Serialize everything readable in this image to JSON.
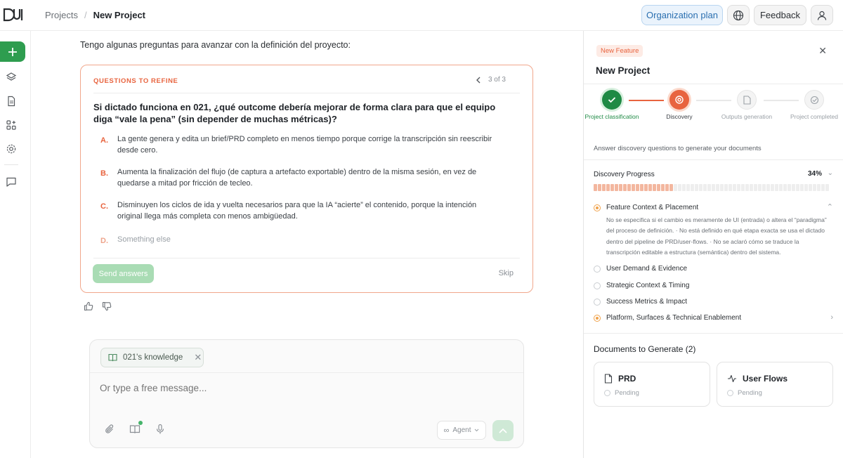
{
  "header": {
    "breadcrumb_root": "Projects",
    "breadcrumb_sep": "/",
    "breadcrumb_current": "New Project",
    "org_plan_label": "Organization plan",
    "feedback_label": "Feedback"
  },
  "colors": {
    "brand_green": "#2e9d4f",
    "accent_orange": "#e8643f",
    "plan_blue": "#2a6fb0"
  },
  "chat": {
    "intro": "Tengo algunas preguntas para avanzar con la definición del proyecto:",
    "questions": {
      "heading": "QUESTIONS TO REFINE",
      "pager": "3 of 3",
      "question": "Si dictado funciona en 021, ¿qué outcome debería mejorar de forma clara para que el equipo diga “vale la pena” (sin depender de muchas métricas)?",
      "options": [
        {
          "letter": "A.",
          "text": "La gente genera y edita un brief/PRD completo en menos tiempo porque corrige la transcripción sin reescribir desde cero."
        },
        {
          "letter": "B.",
          "text": "Aumenta la finalización del flujo (de captura a artefacto exportable) dentro de la misma sesión, en vez de quedarse a mitad por fricción de tecleo."
        },
        {
          "letter": "C.",
          "text": "Disminuyen los ciclos de ida y vuelta necesarios para que la IA “acierte” el contenido, porque la intención original llega más completa con menos ambigüedad."
        },
        {
          "letter": "D.",
          "text": "Something else"
        }
      ],
      "send_label": "Send answers",
      "skip_label": "Skip"
    }
  },
  "composer": {
    "chip_label": "021's knowledge",
    "placeholder": "Or type a free message...",
    "agent_label": "Agent"
  },
  "panel": {
    "badge": "New Feature",
    "title": "New Project",
    "steps": [
      {
        "label": "Project classification",
        "state": "done"
      },
      {
        "label": "Discovery",
        "state": "active"
      },
      {
        "label": "Outputs generation",
        "state": "pending"
      },
      {
        "label": "Project completed",
        "state": "pending"
      }
    ],
    "subtitle": "Answer discovery questions to generate your documents",
    "progress_label": "Discovery Progress",
    "progress_pct_text": "34%",
    "progress_value": 0.34,
    "topics": [
      {
        "label": "Feature Context & Placement",
        "state": "active",
        "description": "No se especifica si el cambio es meramente de UI (entrada) o altera el “paradigma” del proceso de definición. · No está definido en qué etapa exacta se usa el dictado dentro del pipeline de PRD/user-flows. · No se aclaró cómo se traduce la transcripción editable a estructura (semántica) dentro del sistema."
      },
      {
        "label": "User Demand & Evidence",
        "state": "pending"
      },
      {
        "label": "Strategic Context & Timing",
        "state": "pending"
      },
      {
        "label": "Success Metrics & Impact",
        "state": "pending"
      },
      {
        "label": "Platform, Surfaces & Technical Enablement",
        "state": "active"
      }
    ],
    "docs_title": "Documents to Generate (2)",
    "docs": [
      {
        "name": "PRD",
        "status": "Pending",
        "icon": "file-icon"
      },
      {
        "name": "User Flows",
        "status": "Pending",
        "icon": "activity-icon"
      }
    ]
  }
}
